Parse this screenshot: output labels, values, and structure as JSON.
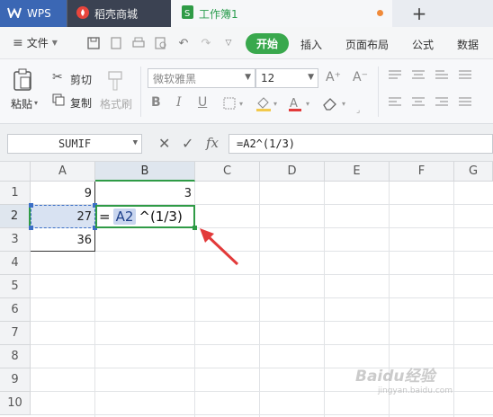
{
  "tabs": {
    "wps_label": "WPS",
    "daoke_label": "稻壳商城",
    "book_label": "工作簿1",
    "plus": "+"
  },
  "menu": {
    "file_label": "文件",
    "start_label": "开始",
    "insert_label": "插入",
    "layout_label": "页面布局",
    "formula_label": "公式",
    "data_label": "数据"
  },
  "ribbon": {
    "paste_label": "粘贴",
    "cut_label": "剪切",
    "copy_label": "复制",
    "format_painter_label": "格式刷",
    "font_name": "微软雅黑",
    "font_size": "12",
    "grow_font": "A⁺",
    "shrink_font": "A⁻",
    "bold": "B",
    "italic": "I",
    "underline": "U"
  },
  "formula_bar": {
    "name_box": "SUMIF",
    "cancel_icon": "✕",
    "confirm_icon": "✓",
    "fx_label": "fx",
    "formula": "=A2^(1/3)"
  },
  "grid": {
    "columns": [
      "A",
      "B",
      "C",
      "D",
      "E",
      "F",
      "G"
    ],
    "rows": [
      "1",
      "2",
      "3",
      "4",
      "5",
      "6",
      "7",
      "8",
      "9",
      "10"
    ],
    "cells": {
      "A1": "9",
      "B1": "3",
      "A2": "27",
      "A3": "36"
    },
    "edit": {
      "eq": "=",
      "ref": "A2",
      "rest": "^(1/3)"
    }
  },
  "watermark": {
    "line1": "Baidu经验",
    "line2": "jingyan.baidu.com"
  },
  "colors": {
    "accent_green": "#2f9b46",
    "wps_blue": "#3b67b4",
    "annotation_red": "#e23a3a"
  }
}
